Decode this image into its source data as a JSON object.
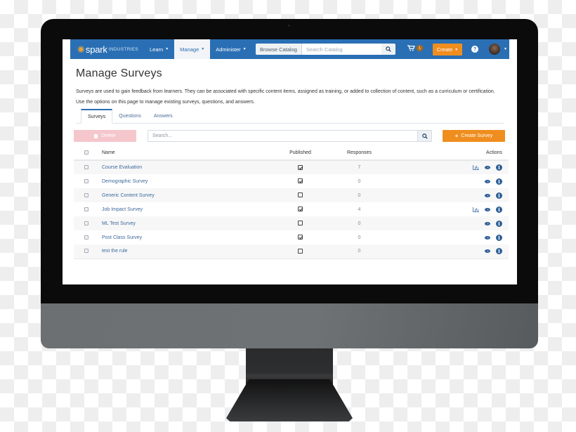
{
  "nav": {
    "logo_text": "spark",
    "logo_subtext": "INDUSTRIES",
    "logo_icon": "spark-burst-icon",
    "items": [
      {
        "label": "Learn",
        "active": false
      },
      {
        "label": "Manage",
        "active": true
      },
      {
        "label": "Administer",
        "active": false
      }
    ],
    "browse_catalog_label": "Browse Catalog",
    "search_catalog_placeholder": "Search Catalog",
    "cart_count": "1",
    "create_label": "Create",
    "help_icon": "question-circle-icon",
    "user_avatar": "user-avatar"
  },
  "page": {
    "title": "Manage Surveys",
    "description": "Surveys are used to gain feedback from learners. They can be associated with specific content items, assigned as training, or added to collection of content, such as a curriculum or certification.",
    "instructions": "Use the options on this page to manage existing surveys, questions, and answers.",
    "tabs": [
      {
        "label": "Surveys",
        "active": true
      },
      {
        "label": "Questions",
        "active": false
      },
      {
        "label": "Answers",
        "active": false
      }
    ]
  },
  "toolbar": {
    "delete_label": "Delete",
    "search_placeholder": "Search...",
    "create_survey_label": "Create Survey"
  },
  "table": {
    "headers": {
      "name": "Name",
      "published": "Published",
      "responses": "Responses",
      "actions": "Actions"
    },
    "rows": [
      {
        "name": "Course Evaluation",
        "published": true,
        "responses": "7",
        "has_report": true
      },
      {
        "name": "Demographic Survey",
        "published": true,
        "responses": "0",
        "has_report": false
      },
      {
        "name": "Generic Content Survey",
        "published": false,
        "responses": "0",
        "has_report": false
      },
      {
        "name": "Job Impact Survey",
        "published": true,
        "responses": "4",
        "has_report": true
      },
      {
        "name": "ML Test Survey",
        "published": false,
        "responses": "0",
        "has_report": false
      },
      {
        "name": "Post Class Survey",
        "published": true,
        "responses": "0",
        "has_report": false
      },
      {
        "name": "test the rule",
        "published": false,
        "responses": "0",
        "has_report": false
      }
    ]
  },
  "colors": {
    "nav_bg": "#2a6fb4",
    "accent_orange": "#ef8e1f",
    "delete_disabled": "#f5c6cc",
    "link": "#3d6a9a"
  }
}
